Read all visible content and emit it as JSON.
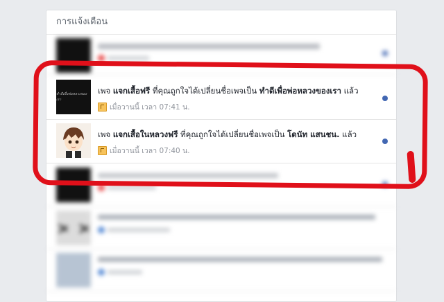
{
  "panel": {
    "title": "การแจ้งเตือน"
  },
  "notifications": [
    {
      "prefix": "เพจ ",
      "page": "แจกเสื้อฟรี",
      "middle": " ที่คุณถูกใจได้เปลี่ยนชื่อเพจเป็น ",
      "new_name": "ทำดีเพื่อพ่อหลวงของเรา",
      "suffix": " แล้ว",
      "time": "เมื่อวานนี้ เวลา 07:41 น.",
      "avatar_text": "ทำดีเพื่อพ่อหลวงของเรา"
    },
    {
      "prefix": "เพจ ",
      "page": "แจกเสื้อในหลวงฟรี",
      "middle": " ที่คุณถูกใจได้เปลี่ยนชื่อเพจเป็น ",
      "new_name": "โดนัท แสนชน.",
      "suffix": " แล้ว",
      "time": "เมื่อวานนี้ เวลา 07:40 น."
    }
  ]
}
